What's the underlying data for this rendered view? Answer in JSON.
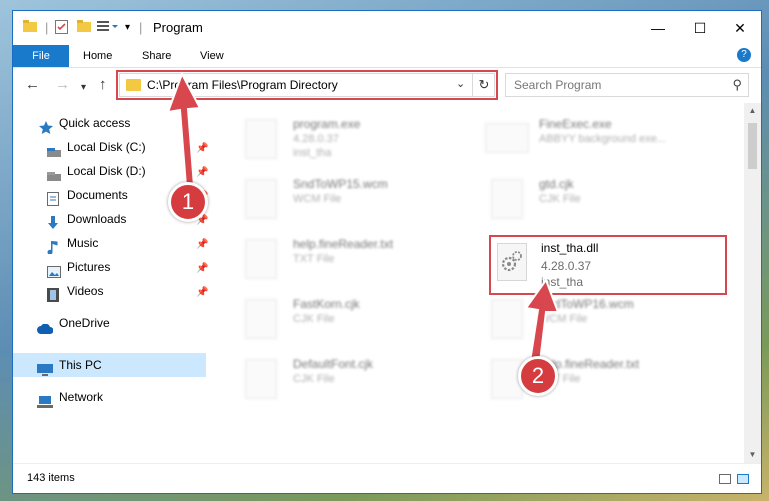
{
  "window": {
    "title": "Program"
  },
  "ribbon": {
    "tabs": [
      "File",
      "Home",
      "Share",
      "View"
    ]
  },
  "address": {
    "path": "C:\\Program Files\\Program Directory"
  },
  "search": {
    "placeholder": "Search Program"
  },
  "sidebar": {
    "items": [
      {
        "label": "Quick access",
        "icon": "star-icon",
        "pinned": false
      },
      {
        "label": "Local Disk (C:)",
        "icon": "drive-icon",
        "pinned": true
      },
      {
        "label": "Local Disk (D:)",
        "icon": "drive-icon",
        "pinned": true
      },
      {
        "label": "Documents",
        "icon": "documents-icon",
        "pinned": true
      },
      {
        "label": "Downloads",
        "icon": "download-icon",
        "pinned": true
      },
      {
        "label": "Music",
        "icon": "music-icon",
        "pinned": true
      },
      {
        "label": "Pictures",
        "icon": "pictures-icon",
        "pinned": true
      },
      {
        "label": "Videos",
        "icon": "videos-icon",
        "pinned": true
      },
      {
        "label": "OneDrive",
        "icon": "cloud-icon",
        "pinned": false
      },
      {
        "label": "This PC",
        "icon": "computer-icon",
        "pinned": false,
        "selected": true
      },
      {
        "label": "Network",
        "icon": "network-icon",
        "pinned": false
      }
    ]
  },
  "files": [
    {
      "name": "program.exe",
      "line2": "4.28.0.37",
      "line3": "inst_tha",
      "blurred": true
    },
    {
      "name": "FineExec.exe",
      "line2": "ABBYY background exe...",
      "line3": "",
      "blurred": true
    },
    {
      "name": "SndToWP15.wcm",
      "line2": "WCM File",
      "line3": "",
      "blurred": true
    },
    {
      "name": "gtd.cjk",
      "line2": "CJK File",
      "line3": "",
      "blurred": true
    },
    {
      "name": "help.fineReader.txt",
      "line2": "TXT File",
      "line3": "",
      "blurred": true
    },
    {
      "name": "inst_tha.dll",
      "line2": "4.28.0.37",
      "line3": "inst_tha",
      "blurred": false
    },
    {
      "name": "FastKorn.cjk",
      "line2": "CJK File",
      "line3": "",
      "blurred": true
    },
    {
      "name": "SndToWP16.wcm",
      "line2": "WCM File",
      "line3": "",
      "blurred": true
    },
    {
      "name": "DefaultFont.cjk",
      "line2": "CJK File",
      "line3": "",
      "blurred": true
    },
    {
      "name": "help.fineReader.txt",
      "line2": "TXT File",
      "line3": "",
      "blurred": true
    }
  ],
  "status": {
    "items": "143 items"
  },
  "annotations": {
    "step1": "1",
    "step2": "2",
    "color": "#d8474e"
  }
}
